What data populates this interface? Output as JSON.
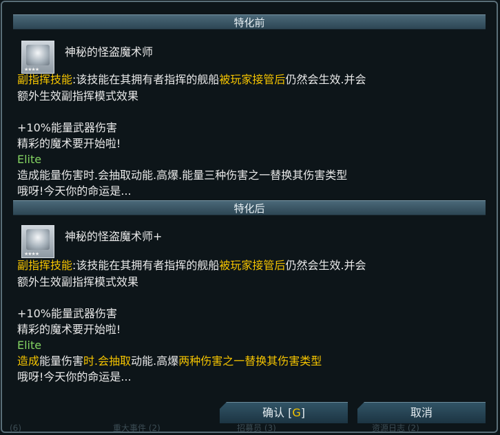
{
  "before": {
    "header": "特化前",
    "skill_name": "神秘的怪盗魔术师",
    "line1_a": "副指挥技能",
    "line1_b": ":该技能在其拥有者指挥的舰船",
    "line1_c": "被玩家接管后",
    "line1_d": "仍然会生效.并会",
    "line2": "额外生效副指挥模式效果",
    "line3": "+10%能量武器伤害",
    "line4": "精彩的魔术要开始啦!",
    "line5": "Elite",
    "line6": "造成能量伤害时.会抽取动能.高爆.能量三种伤害之一替换其伤害类型",
    "line7": "哦呀!今天你的命运是..."
  },
  "after": {
    "header": "特化后",
    "skill_name": "神秘的怪盗魔术师+",
    "line1_a": "副指挥技能",
    "line1_b": ":该技能在其拥有者指挥的舰船",
    "line1_c": "被玩家接管后",
    "line1_d": "仍然会生效.并会",
    "line2": "额外生效副指挥模式效果",
    "line3": "+10%能量武器伤害",
    "line4": "精彩的魔术要开始啦!",
    "line5": "Elite",
    "line6_a": "造成",
    "line6_b": "能量伤害",
    "line6_c": "时.会抽取",
    "line6_d": "动能.高爆",
    "line6_e": "两种伤害之一替换其伤害类型",
    "line7": "哦呀!今天你的命运是..."
  },
  "buttons": {
    "confirm_label": "确认 [",
    "confirm_key": "G",
    "confirm_close": "]",
    "cancel_label": "取消"
  },
  "background_tabs": {
    "tab1": "(6)",
    "tab2": "重大事件 (2)",
    "tab3": "招募员 (3)",
    "tab4": "资源日志 (2)"
  },
  "colors": {
    "highlight": "#f5c400",
    "elite": "#84d462",
    "header_bg": "#3b5a6a"
  }
}
